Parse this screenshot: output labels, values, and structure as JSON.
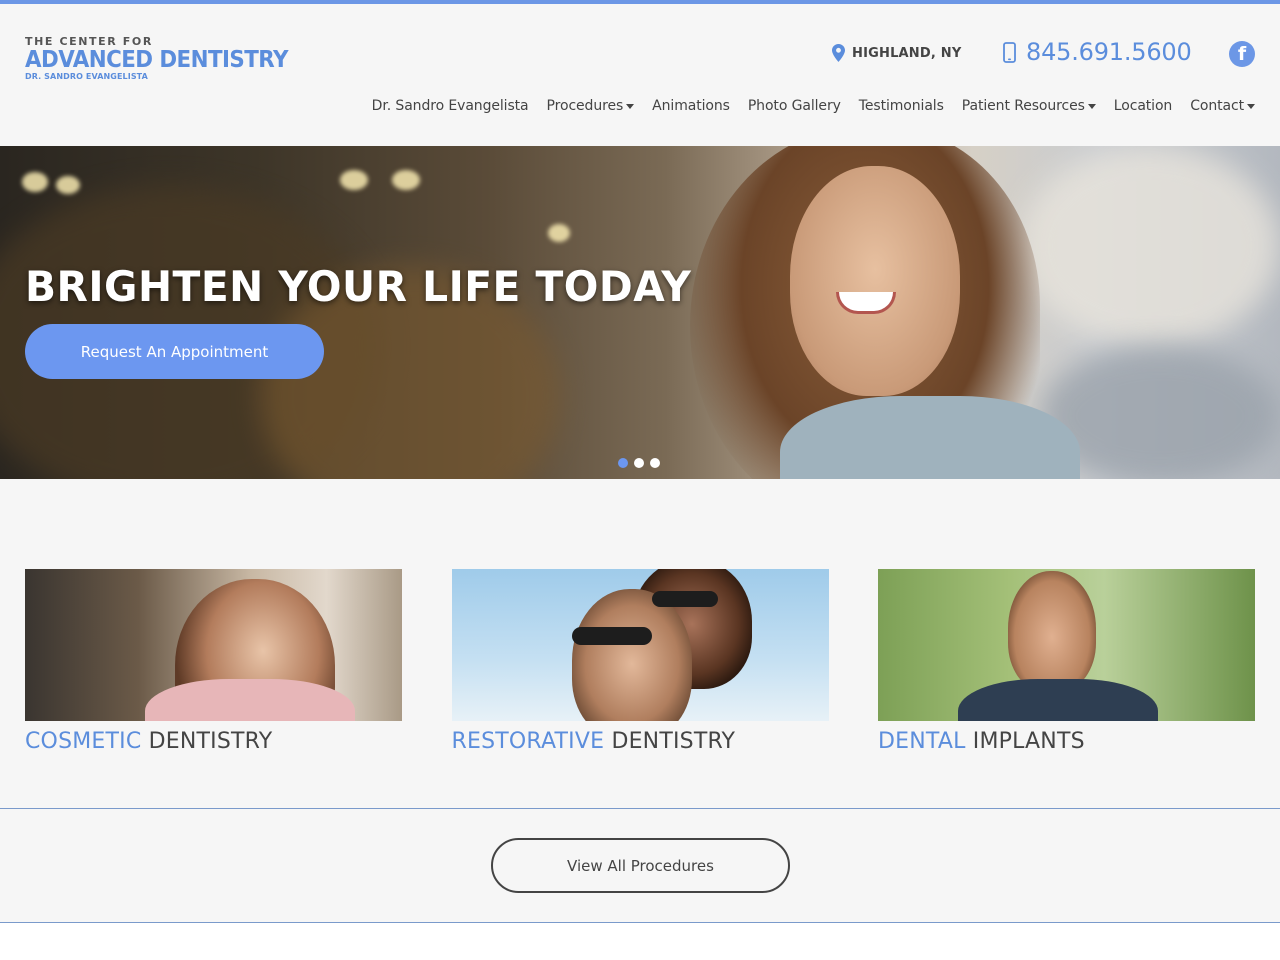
{
  "brand": {
    "line1": "THE CENTER FOR",
    "line2": "ADVANCED DENTISTRY",
    "line3": "DR. SANDRO EVANGELISTA",
    "accent_color": "#5b8ddc"
  },
  "contact": {
    "location": "HIGHLAND, NY",
    "phone": "845.691.5600",
    "facebook_glyph": "f",
    "location_icon": "map-pin-icon",
    "phone_icon": "mobile-phone-icon"
  },
  "nav": {
    "items": [
      {
        "label": "Dr. Sandro Evangelista",
        "dropdown": false
      },
      {
        "label": "Procedures",
        "dropdown": true
      },
      {
        "label": "Animations",
        "dropdown": false
      },
      {
        "label": "Photo Gallery",
        "dropdown": false
      },
      {
        "label": "Testimonials",
        "dropdown": false
      },
      {
        "label": "Patient Resources",
        "dropdown": true
      },
      {
        "label": "Location",
        "dropdown": false
      },
      {
        "label": "Contact",
        "dropdown": true
      }
    ]
  },
  "hero": {
    "headline": "BRIGHTEN YOUR LIFE TODAY",
    "cta_label": "Request An Appointment",
    "slides_total": 3,
    "active_slide": 1
  },
  "cards": [
    {
      "accent": "COSMETIC",
      "rest": "DENTISTRY"
    },
    {
      "accent": "RESTORATIVE",
      "rest": "DENTISTRY"
    },
    {
      "accent": "DENTAL",
      "rest": "IMPLANTS"
    }
  ],
  "procedures_button": "View All Procedures"
}
